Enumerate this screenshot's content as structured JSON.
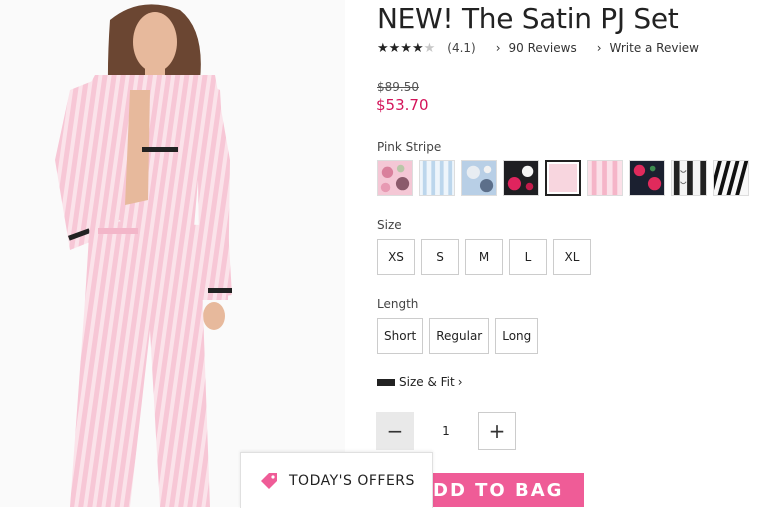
{
  "product": {
    "title": "NEW! The Satin PJ Set",
    "rating_value": "(4.1)",
    "reviews_link": "90 Reviews",
    "write_review_link": "Write a Review",
    "price_original": "$89.50",
    "price_sale": "$53.70",
    "sale_color": "#d4145a"
  },
  "color": {
    "label": "Pink Stripe",
    "swatches": [
      {
        "name": "Pink Floral"
      },
      {
        "name": "Blue Stripe"
      },
      {
        "name": "Blue Floral"
      },
      {
        "name": "Black Floral"
      },
      {
        "name": "Pink Solid",
        "selected": true
      },
      {
        "name": "Pink Stripe"
      },
      {
        "name": "Navy Rose"
      },
      {
        "name": "Black Script"
      },
      {
        "name": "Black Stripe"
      }
    ]
  },
  "size": {
    "label": "Size",
    "options": [
      "XS",
      "S",
      "M",
      "L",
      "XL"
    ]
  },
  "length": {
    "label": "Length",
    "options": [
      "Short",
      "Regular",
      "Long"
    ]
  },
  "size_fit": {
    "label": "Size & Fit",
    "icon": "ruler-icon"
  },
  "quantity": {
    "minus": "−",
    "value": "1",
    "plus": "+"
  },
  "cta": {
    "add_to_bag": "DD TO BAG",
    "button_color": "#ef5c97",
    "offers_label": "TODAY'S OFFERS",
    "offers_icon": "tag-icon"
  }
}
